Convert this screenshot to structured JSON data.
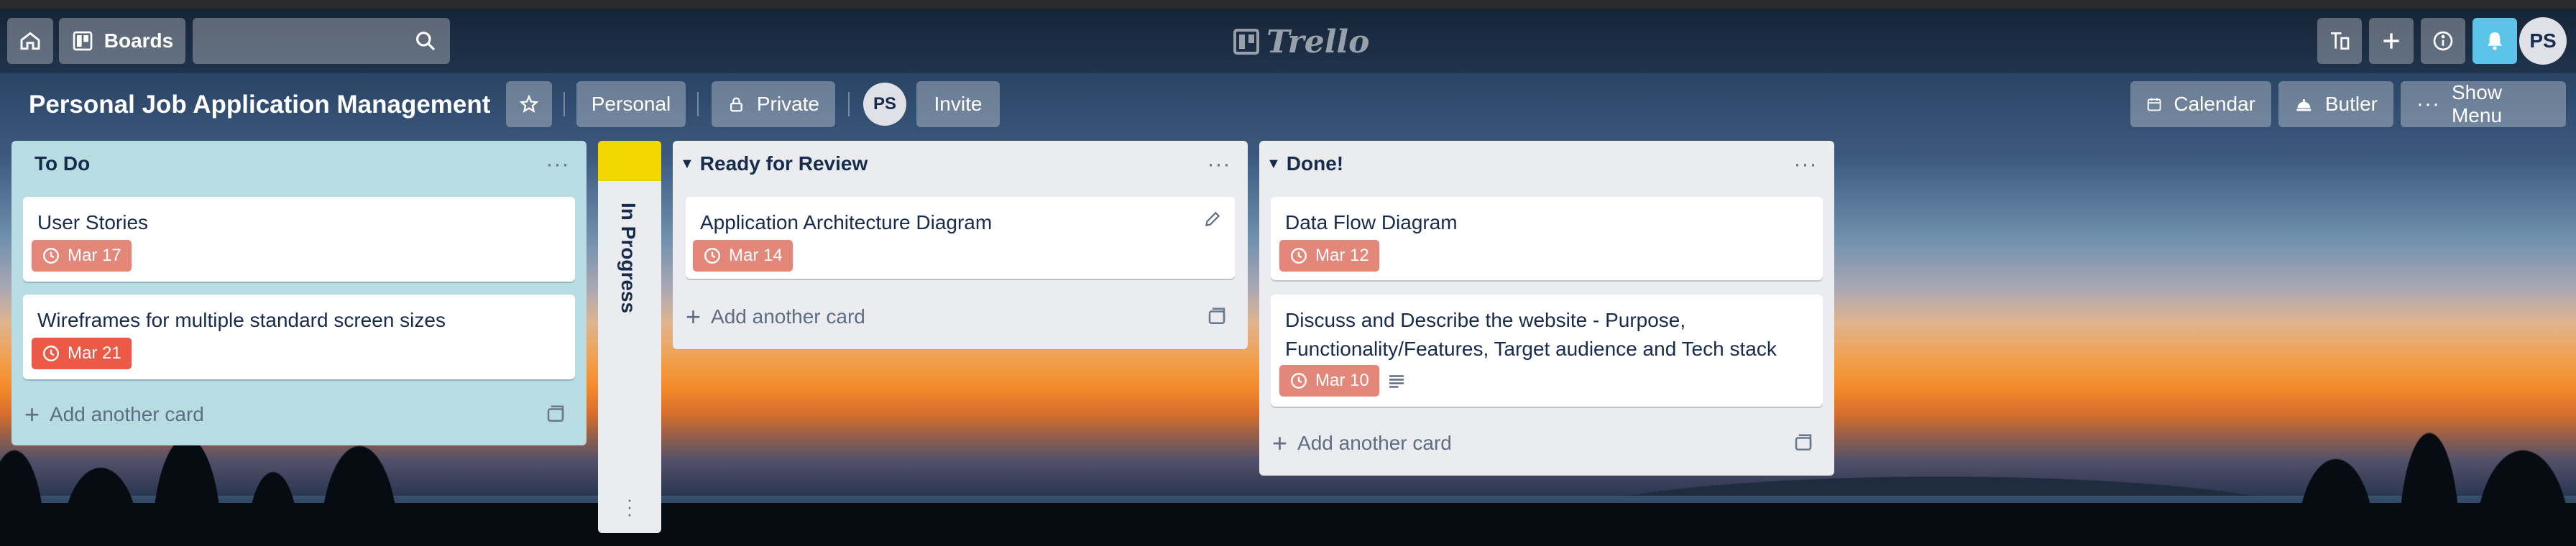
{
  "topbar": {
    "home_icon": "home-icon",
    "boards_label": "Boards",
    "search_value": "",
    "logo_text": "Trello",
    "avatar_initials": "PS"
  },
  "board": {
    "title": "Personal Job Application Management",
    "team_label": "Personal",
    "visibility_label": "Private",
    "member_initials": "PS",
    "invite_label": "Invite",
    "calendar_label": "Calendar",
    "butler_label": "Butler",
    "menu_label": "Show Menu"
  },
  "lists": {
    "todo": {
      "title": "To Do",
      "cards": [
        {
          "title": "User Stories",
          "due": "Mar 17"
        },
        {
          "title": "Wireframes for multiple standard screen sizes",
          "due": "Mar 21"
        }
      ],
      "add_label": "Add another card"
    },
    "in_progress": {
      "title": "In Progress",
      "label_color": "#f2d600"
    },
    "review": {
      "title": "Ready for Review",
      "cards": [
        {
          "title": "Application Architecture Diagram",
          "due": "Mar 14"
        }
      ],
      "add_label": "Add another card"
    },
    "done": {
      "title": "Done!",
      "cards": [
        {
          "title": "Data Flow Diagram",
          "due": "Mar 12"
        },
        {
          "title": "Discuss and Describe the website - Purpose, Functionality/Features, Target audience and Tech stack",
          "due": "Mar 10"
        }
      ],
      "add_label": "Add another card"
    }
  },
  "colors": {
    "due_overdue": "#eb5a46",
    "due_past": "#e2877a",
    "list_todo_bg": "#b7dde3",
    "list_bg": "#ebecf0",
    "notification_button": "#5bc4e8"
  }
}
